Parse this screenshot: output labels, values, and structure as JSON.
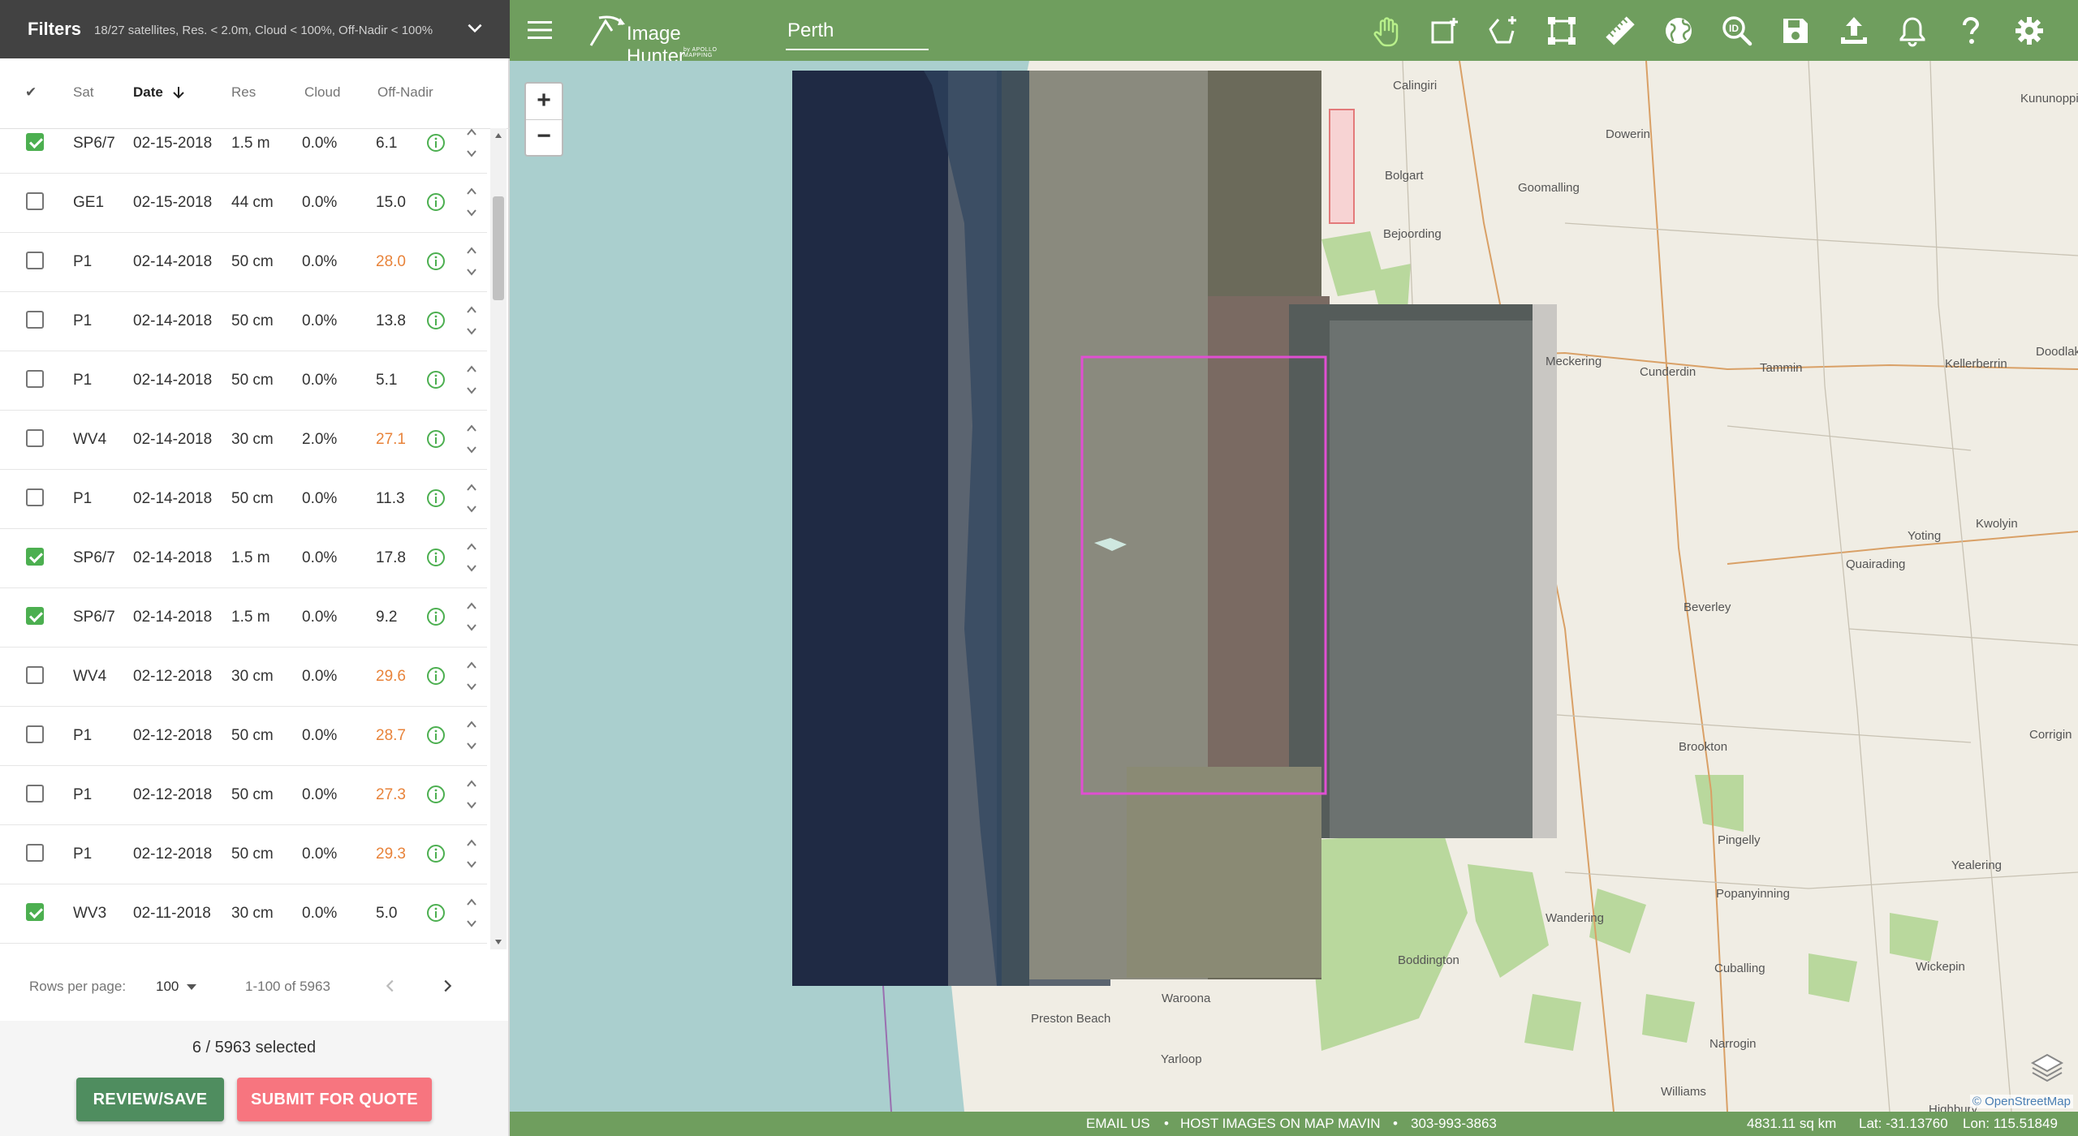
{
  "filters": {
    "title": "Filters",
    "summary": "18/27 satellites, Res. < 2.0m, Cloud < 100%, Off-Nadir < 100%"
  },
  "columns": {
    "check": "✔",
    "sat": "Sat",
    "date": "Date",
    "res": "Res",
    "cloud": "Cloud",
    "off_nadir": "Off-Nadir"
  },
  "rows": [
    {
      "checked": true,
      "sat": "SP6/7",
      "date": "02-15-2018",
      "res": "1.5 m",
      "cloud": "0.0%",
      "off_nadir": "6.1",
      "warn": false
    },
    {
      "checked": false,
      "sat": "GE1",
      "date": "02-15-2018",
      "res": "44 cm",
      "cloud": "0.0%",
      "off_nadir": "15.0",
      "warn": false
    },
    {
      "checked": false,
      "sat": "P1",
      "date": "02-14-2018",
      "res": "50 cm",
      "cloud": "0.0%",
      "off_nadir": "28.0",
      "warn": true
    },
    {
      "checked": false,
      "sat": "P1",
      "date": "02-14-2018",
      "res": "50 cm",
      "cloud": "0.0%",
      "off_nadir": "13.8",
      "warn": false
    },
    {
      "checked": false,
      "sat": "P1",
      "date": "02-14-2018",
      "res": "50 cm",
      "cloud": "0.0%",
      "off_nadir": "5.1",
      "warn": false
    },
    {
      "checked": false,
      "sat": "WV4",
      "date": "02-14-2018",
      "res": "30 cm",
      "cloud": "2.0%",
      "off_nadir": "27.1",
      "warn": true
    },
    {
      "checked": false,
      "sat": "P1",
      "date": "02-14-2018",
      "res": "50 cm",
      "cloud": "0.0%",
      "off_nadir": "11.3",
      "warn": false
    },
    {
      "checked": true,
      "sat": "SP6/7",
      "date": "02-14-2018",
      "res": "1.5 m",
      "cloud": "0.0%",
      "off_nadir": "17.8",
      "warn": false
    },
    {
      "checked": true,
      "sat": "SP6/7",
      "date": "02-14-2018",
      "res": "1.5 m",
      "cloud": "0.0%",
      "off_nadir": "9.2",
      "warn": false
    },
    {
      "checked": false,
      "sat": "WV4",
      "date": "02-12-2018",
      "res": "30 cm",
      "cloud": "0.0%",
      "off_nadir": "29.6",
      "warn": true
    },
    {
      "checked": false,
      "sat": "P1",
      "date": "02-12-2018",
      "res": "50 cm",
      "cloud": "0.0%",
      "off_nadir": "28.7",
      "warn": true
    },
    {
      "checked": false,
      "sat": "P1",
      "date": "02-12-2018",
      "res": "50 cm",
      "cloud": "0.0%",
      "off_nadir": "27.3",
      "warn": true
    },
    {
      "checked": false,
      "sat": "P1",
      "date": "02-12-2018",
      "res": "50 cm",
      "cloud": "0.0%",
      "off_nadir": "29.3",
      "warn": true
    },
    {
      "checked": true,
      "sat": "WV3",
      "date": "02-11-2018",
      "res": "30 cm",
      "cloud": "0.0%",
      "off_nadir": "5.0",
      "warn": false
    }
  ],
  "pager": {
    "rows_label": "Rows per page:",
    "rows_value": "100",
    "range": "1-100 of 5963"
  },
  "selection": {
    "text": "6 / 5963 selected"
  },
  "buttons": {
    "review": "REVIEW/SAVE",
    "quote": "SUBMIT FOR QUOTE"
  },
  "toolbar": {
    "logo_text": "Image Hunter",
    "logo_sub": "by APOLLO MAPPING",
    "search_value": "Perth",
    "tools": [
      "pan-hand-icon",
      "draw-rectangle-icon",
      "draw-polygon-icon",
      "bounding-box-icon",
      "ruler-icon",
      "globe-icon",
      "id-search-icon",
      "save-icon",
      "upload-icon",
      "bell-icon",
      "help-icon",
      "settings-icon"
    ]
  },
  "map": {
    "zoom_in": "+",
    "zoom_out": "−",
    "places": [
      "Calingiri",
      "Kununoppin",
      "Dowerin",
      "Bolgart",
      "Goomalling",
      "Bejoording",
      "Meckering",
      "Cunderdin",
      "Tammin",
      "Kellerberrin",
      "Doodlakine",
      "Kwolyin",
      "Yoting",
      "Quairading",
      "Beverley",
      "Brookton",
      "Corrigin",
      "Pingelly",
      "Yealering",
      "Popanyinning",
      "Wandering",
      "Boddington",
      "Cuballing",
      "Wickepin",
      "Narrogin",
      "Waroona",
      "Preston Beach",
      "Yarloop",
      "Williams",
      "Highbury"
    ],
    "attribution": "© OpenStreetMap",
    "colors": {
      "ocean": "#aacfce",
      "land": "#f0ede4",
      "forest": "#b9d89d",
      "selection": "#e04fd2"
    }
  },
  "status": {
    "email": "EMAIL US",
    "host": "HOST IMAGES ON MAP MAVIN",
    "phone": "303-993-3863",
    "area": "4831.11 sq km",
    "lat": "Lat: -31.13760",
    "lon": "Lon: 115.51849"
  },
  "colors": {
    "toolbar": "#6f9e5e",
    "filters_bar": "#424242",
    "check": "#4caf50",
    "warn": "#e8833a",
    "review_btn": "#4f8d5f",
    "quote_btn": "#f7757f"
  }
}
